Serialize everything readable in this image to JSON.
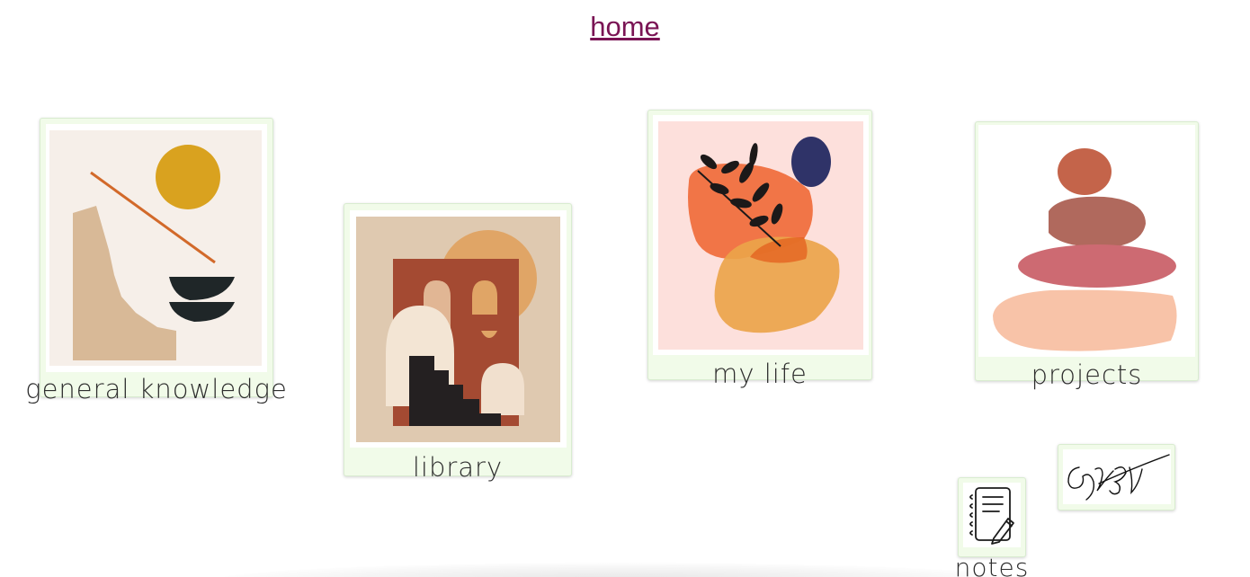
{
  "header": {
    "home_link": "home"
  },
  "cards": {
    "general": {
      "caption": "general knowledge"
    },
    "library": {
      "caption": "library"
    },
    "mylife": {
      "caption": "my life"
    },
    "projects": {
      "caption": "projects"
    },
    "notes": {
      "caption": "notes"
    }
  },
  "icons": {
    "notes": "notebook-pencil-icon",
    "signature": "signature-image"
  },
  "colors": {
    "link": "#7a1454",
    "card_frame": "#f1fbe9"
  }
}
